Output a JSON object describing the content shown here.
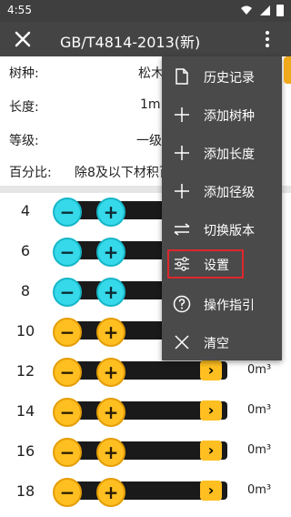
{
  "status_bar": {
    "time": "4:55"
  },
  "app_bar": {
    "title": "GB/T4814-2013(新)"
  },
  "info": {
    "species_label": "树种:",
    "species_value": "松木",
    "length_label": "长度:",
    "length_value": "1m",
    "grade_label": "等级:",
    "grade_value": "一级",
    "percent_label": "百分比:",
    "percent_value": "除8及以下材积百"
  },
  "rows": [
    {
      "diameter": "4",
      "volume": "",
      "style": "cyan"
    },
    {
      "diameter": "6",
      "volume": "",
      "style": "cyan"
    },
    {
      "diameter": "8",
      "volume": "",
      "style": "cyan"
    },
    {
      "diameter": "10",
      "volume": "",
      "style": "yellow"
    },
    {
      "diameter": "12",
      "volume": "0m³",
      "style": "yellow"
    },
    {
      "diameter": "14",
      "volume": "0m³",
      "style": "yellow"
    },
    {
      "diameter": "16",
      "volume": "0m³",
      "style": "yellow"
    },
    {
      "diameter": "18",
      "volume": "0m³",
      "style": "yellow"
    }
  ],
  "menu": {
    "items": [
      {
        "label": "历史记录",
        "icon": "document-icon"
      },
      {
        "label": "添加树种",
        "icon": "plus-icon"
      },
      {
        "label": "添加长度",
        "icon": "plus-icon"
      },
      {
        "label": "添加径级",
        "icon": "plus-icon"
      },
      {
        "label": "切换版本",
        "icon": "swap-icon"
      },
      {
        "label": "设置",
        "icon": "sliders-icon"
      },
      {
        "label": "操作指引",
        "icon": "help-icon"
      },
      {
        "label": "清空",
        "icon": "close-icon"
      }
    ]
  },
  "colors": {
    "app_bar": "#444444",
    "cyan": "#35d9e9",
    "yellow": "#ffbf20",
    "highlight": "#e0262c"
  }
}
